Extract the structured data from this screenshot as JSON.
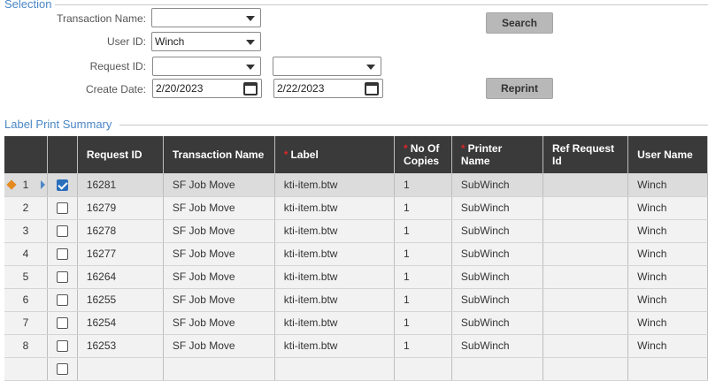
{
  "selection": {
    "legend": "Selection",
    "transaction_name_label": "Transaction Name:",
    "transaction_name_value": "",
    "user_id_label": "User ID:",
    "user_id_value": "Winch",
    "request_id_label": "Request ID:",
    "request_id_from": "",
    "request_id_to": "",
    "create_date_label": "Create Date:",
    "create_date_from": "2/20/2023",
    "create_date_to": "2/22/2023",
    "search_label": "Search",
    "reprint_label": "Reprint"
  },
  "summary": {
    "legend": "Label Print Summary",
    "columns": {
      "request_id": "Request ID",
      "transaction_name": "Transaction Name",
      "label": "Label",
      "no_of_copies": "No Of Copies",
      "printer_name": "Printer Name",
      "ref_request_id": "Ref Request Id",
      "user_name": "User Name"
    },
    "required_marker": "*",
    "rows": [
      {
        "num": "1",
        "checked": true,
        "request_id": "16281",
        "transaction_name": "SF Job Move",
        "label": "kti-item.btw",
        "copies": "1",
        "printer": "SubWinch",
        "ref_request_id": "",
        "user": "Winch"
      },
      {
        "num": "2",
        "checked": false,
        "request_id": "16279",
        "transaction_name": "SF Job Move",
        "label": "kti-item.btw",
        "copies": "1",
        "printer": "SubWinch",
        "ref_request_id": "",
        "user": "Winch"
      },
      {
        "num": "3",
        "checked": false,
        "request_id": "16278",
        "transaction_name": "SF Job Move",
        "label": "kti-item.btw",
        "copies": "1",
        "printer": "SubWinch",
        "ref_request_id": "",
        "user": "Winch"
      },
      {
        "num": "4",
        "checked": false,
        "request_id": "16277",
        "transaction_name": "SF Job Move",
        "label": "kti-item.btw",
        "copies": "1",
        "printer": "SubWinch",
        "ref_request_id": "",
        "user": "Winch"
      },
      {
        "num": "5",
        "checked": false,
        "request_id": "16264",
        "transaction_name": "SF Job Move",
        "label": "kti-item.btw",
        "copies": "1",
        "printer": "SubWinch",
        "ref_request_id": "",
        "user": "Winch"
      },
      {
        "num": "6",
        "checked": false,
        "request_id": "16255",
        "transaction_name": "SF Job Move",
        "label": "kti-item.btw",
        "copies": "1",
        "printer": "SubWinch",
        "ref_request_id": "",
        "user": "Winch"
      },
      {
        "num": "7",
        "checked": false,
        "request_id": "16254",
        "transaction_name": "SF Job Move",
        "label": "kti-item.btw",
        "copies": "1",
        "printer": "SubWinch",
        "ref_request_id": "",
        "user": "Winch"
      },
      {
        "num": "8",
        "checked": false,
        "request_id": "16253",
        "transaction_name": "SF Job Move",
        "label": "kti-item.btw",
        "copies": "1",
        "printer": "SubWinch",
        "ref_request_id": "",
        "user": "Winch"
      }
    ]
  },
  "colors": {
    "accent": "#4a86c5",
    "header_bg": "#3a3a3a",
    "required": "#d9262b",
    "row_marker": "#e58a1f",
    "checkbox_checked": "#2a6ebb"
  }
}
